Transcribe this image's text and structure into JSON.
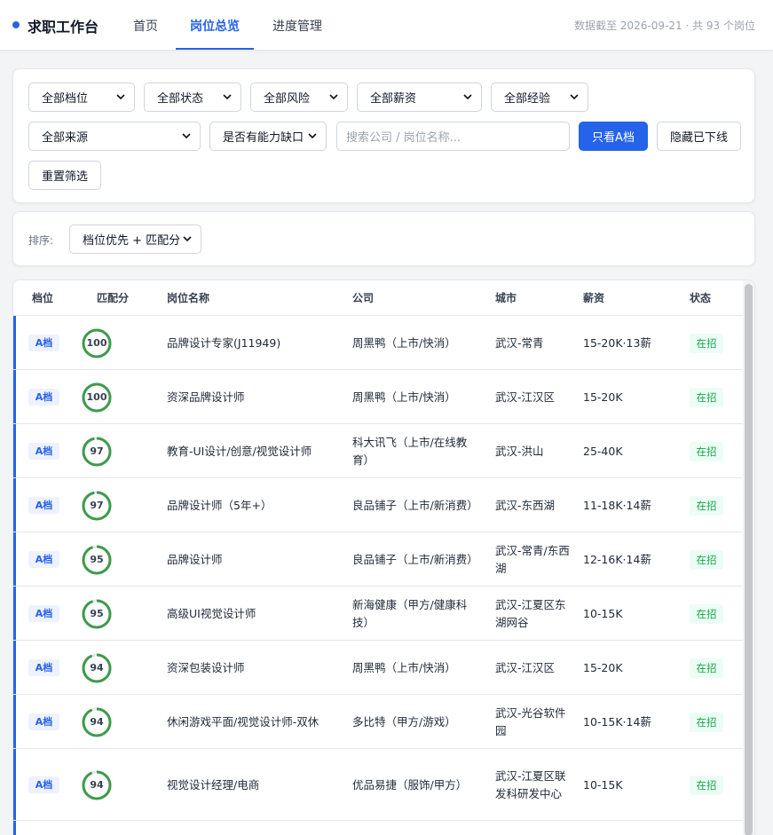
{
  "header": {
    "brand": "求职工作台",
    "tabs": [
      "首页",
      "岗位总览",
      "进度管理"
    ],
    "meta": "数据截至 2026-09-21 · 共 93 个岗位"
  },
  "filters": {
    "tier": "全部档位",
    "status": "全部状态",
    "risk": "全部风险",
    "salary": "全部薪资",
    "experience": "全部经验",
    "source": "全部来源",
    "gap": "是否有能力缺口",
    "search_placeholder": "搜索公司 / 岗位名称...",
    "only_a": "只看A档",
    "hide_offline": "隐藏已下线",
    "reset": "重置筛选"
  },
  "sort": {
    "label": "排序:",
    "value": "档位优先 + 匹配分"
  },
  "table": {
    "headers": [
      "档位",
      "匹配分",
      "岗位名称",
      "公司",
      "城市",
      "薪资",
      "状态"
    ],
    "rows": [
      {
        "tier": "A档",
        "score": 100,
        "title": "品牌设计专家(J11949)",
        "company": "周黑鸭（上市/快消）",
        "city": "武汉-常青",
        "salary": "15-20K·13薪",
        "status": "在招"
      },
      {
        "tier": "A档",
        "score": 100,
        "title": "资深品牌设计师",
        "company": "周黑鸭（上市/快消）",
        "city": "武汉-江汉区",
        "salary": "15-20K",
        "status": "在招"
      },
      {
        "tier": "A档",
        "score": 97,
        "title": "教育-UI设计/创意/视觉设计师",
        "company": "科大讯飞（上市/在线教育）",
        "city": "武汉-洪山",
        "salary": "25-40K",
        "status": "在招"
      },
      {
        "tier": "A档",
        "score": 97,
        "title": "品牌设计师（5年+）",
        "company": "良品铺子（上市/新消费）",
        "city": "武汉-东西湖",
        "salary": "11-18K·14薪",
        "status": "在招"
      },
      {
        "tier": "A档",
        "score": 95,
        "title": "品牌设计师",
        "company": "良品铺子（上市/新消费）",
        "city": "武汉-常青/东西湖",
        "salary": "12-16K·14薪",
        "status": "在招"
      },
      {
        "tier": "A档",
        "score": 95,
        "title": "高级UI视觉设计师",
        "company": "新海健康（甲方/健康科技）",
        "city": "武汉-江夏区东湖网谷",
        "salary": "10-15K",
        "status": "在招"
      },
      {
        "tier": "A档",
        "score": 94,
        "title": "资深包装设计师",
        "company": "周黑鸭（上市/快消）",
        "city": "武汉-江汉区",
        "salary": "15-20K",
        "status": "在招"
      },
      {
        "tier": "A档",
        "score": 94,
        "title": "休闲游戏平面/视觉设计师-双休",
        "company": "多比特（甲方/游戏）",
        "city": "武汉-光谷软件园",
        "salary": "10-15K·14薪",
        "status": "在招"
      },
      {
        "tier": "A档",
        "score": 94,
        "title": "视觉设计经理/电商",
        "company": "优品易捷（服饰/甲方）",
        "city": "武汉-江夏区联发科研发中心",
        "salary": "10-15K",
        "status": "在招"
      }
    ]
  },
  "colors": {
    "accent": "#2563eb",
    "score_ring": "#3f9a4c",
    "status_green": "#16a34a"
  }
}
